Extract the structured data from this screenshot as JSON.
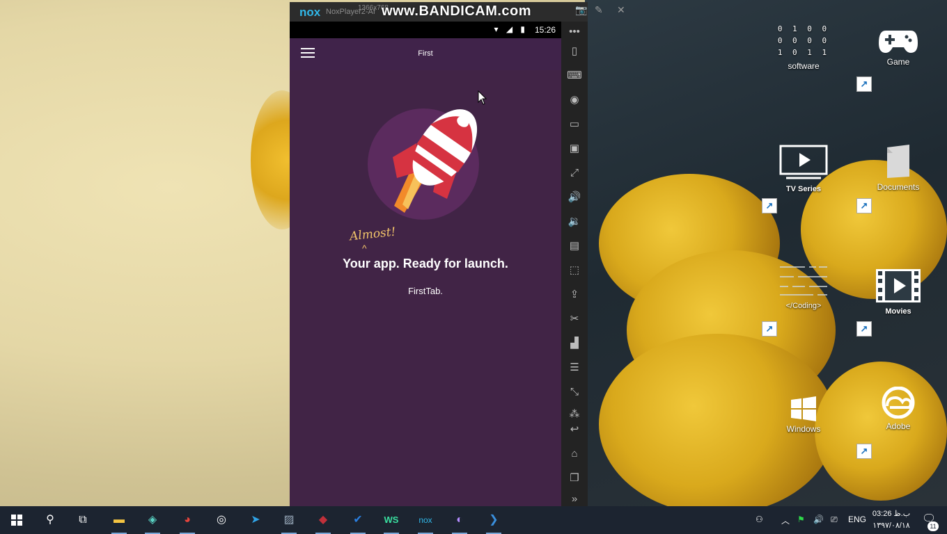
{
  "nox": {
    "logo": "nox",
    "window_name": "NoxPlayer2-Af",
    "resolution": "1366x768",
    "watermark": "www.BANDICAM.com"
  },
  "android": {
    "status": {
      "time": "15:26",
      "icons": "▾ ◢ ▮"
    },
    "appbar": {
      "title": "First"
    },
    "hero": {
      "tag": "Almost!",
      "caret": "^",
      "headline": "Your app. Ready for launch."
    },
    "tab_text": "FirstTab."
  },
  "nox_toolbar": [
    "more-icon",
    "phone-shake-icon",
    "keyboard-icon",
    "location-icon",
    "screen-icon",
    "apk-icon",
    "fullscreen-icon",
    "volume-up-icon",
    "volume-down-icon",
    "screenshot-icon",
    "macro-icon",
    "install-icon",
    "cut-icon",
    "multi-instance-icon",
    "menu-icon",
    "restore-icon",
    "loading-icon",
    "back-icon",
    "home-icon",
    "recents-icon",
    "expand-icon"
  ],
  "desktop": {
    "software": {
      "label": "software",
      "bits": [
        "0 1 0 0",
        "0 0 0 0",
        "1 0 1 1"
      ]
    },
    "game": {
      "label": "Game"
    },
    "tv_series": {
      "label": "TV Series"
    },
    "documents": {
      "label": "Documents"
    },
    "coding": {
      "label": "</Coding>"
    },
    "movies": {
      "label": "Movies"
    },
    "windows": {
      "label": "Windows"
    },
    "adobe": {
      "label": "Adobe"
    }
  },
  "taskbar": {
    "lang": "ENG",
    "time": "03:26 ب.ظ",
    "date": "۱۳۹۷/۰۸/۱۸",
    "notification_count": "11"
  },
  "colors": {
    "android_bg": "#412446",
    "accent_text": "#f2c56a",
    "rocket_red": "#d63341"
  }
}
